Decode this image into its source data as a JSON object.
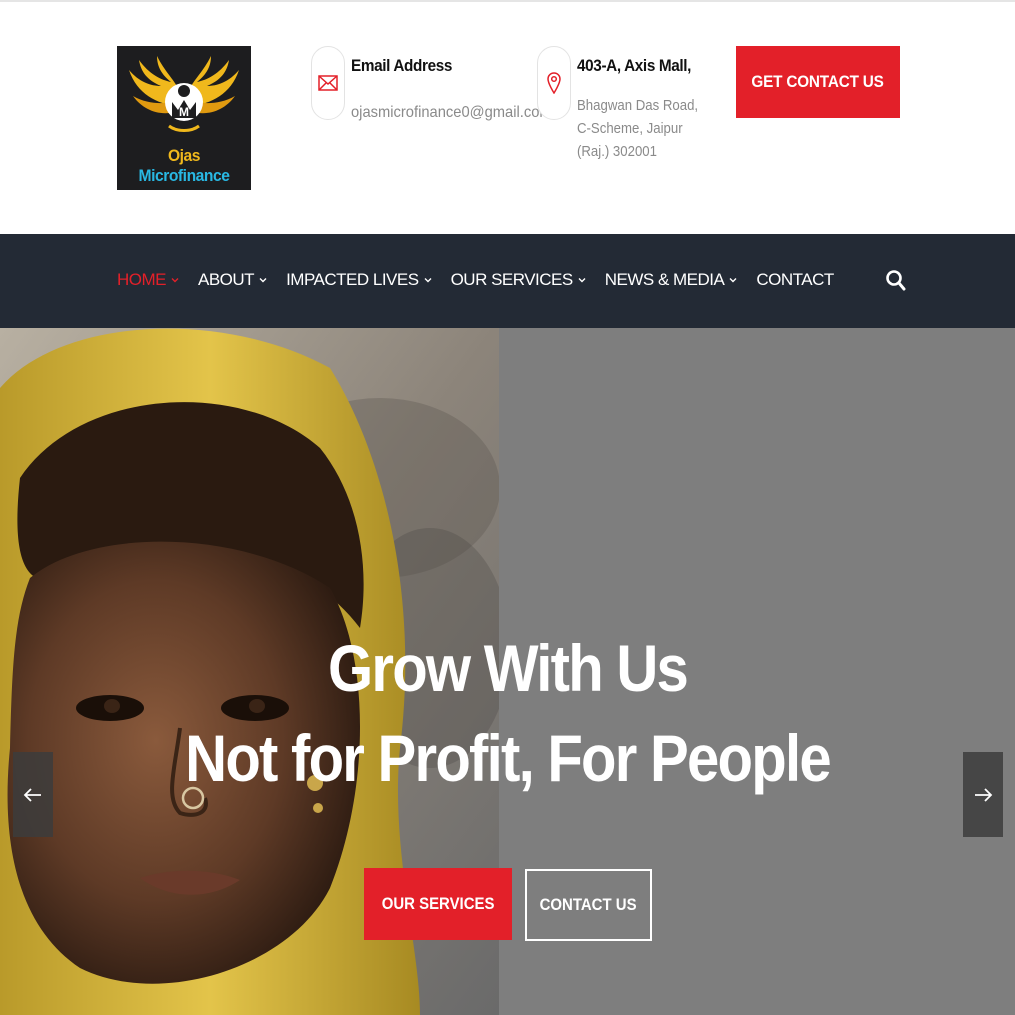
{
  "header": {
    "logo": {
      "word1": "Ojas",
      "word2": "Microfinance",
      "alt": "Ojas Microfinance logo"
    },
    "email": {
      "title": "Email Address",
      "value": "ojasmicrofinance0@gmail.com",
      "icon": "envelope-icon"
    },
    "address": {
      "title": "403-A, Axis Mall,",
      "value": "Bhagwan Das Road,\nC-Scheme, Jaipur\n(Raj.) 302001",
      "icon": "map-pin-icon"
    },
    "cta_label": "GET CONTACT US"
  },
  "nav": {
    "items": [
      {
        "label": "HOME",
        "active": true,
        "has_dropdown": true
      },
      {
        "label": "ABOUT",
        "active": false,
        "has_dropdown": true
      },
      {
        "label": "IMPACTED LIVES",
        "active": false,
        "has_dropdown": true
      },
      {
        "label": "OUR SERVICES",
        "active": false,
        "has_dropdown": true
      },
      {
        "label": "NEWS & MEDIA",
        "active": false,
        "has_dropdown": true
      },
      {
        "label": "CONTACT",
        "active": false,
        "has_dropdown": false
      }
    ],
    "search_icon": "search-icon"
  },
  "hero": {
    "line1": "Grow With Us",
    "line2": "Not for Profit, For People",
    "primary_button": "OUR SERVICES",
    "secondary_button": "CONTACT US",
    "prev_icon": "arrow-left-icon",
    "next_icon": "arrow-right-icon"
  },
  "colors": {
    "accent": "#e32029",
    "nav_bg": "#232a35",
    "hero_bg": "#7e7e7e",
    "logo_gold": "#f0b81c",
    "logo_blue": "#29b8e3"
  }
}
